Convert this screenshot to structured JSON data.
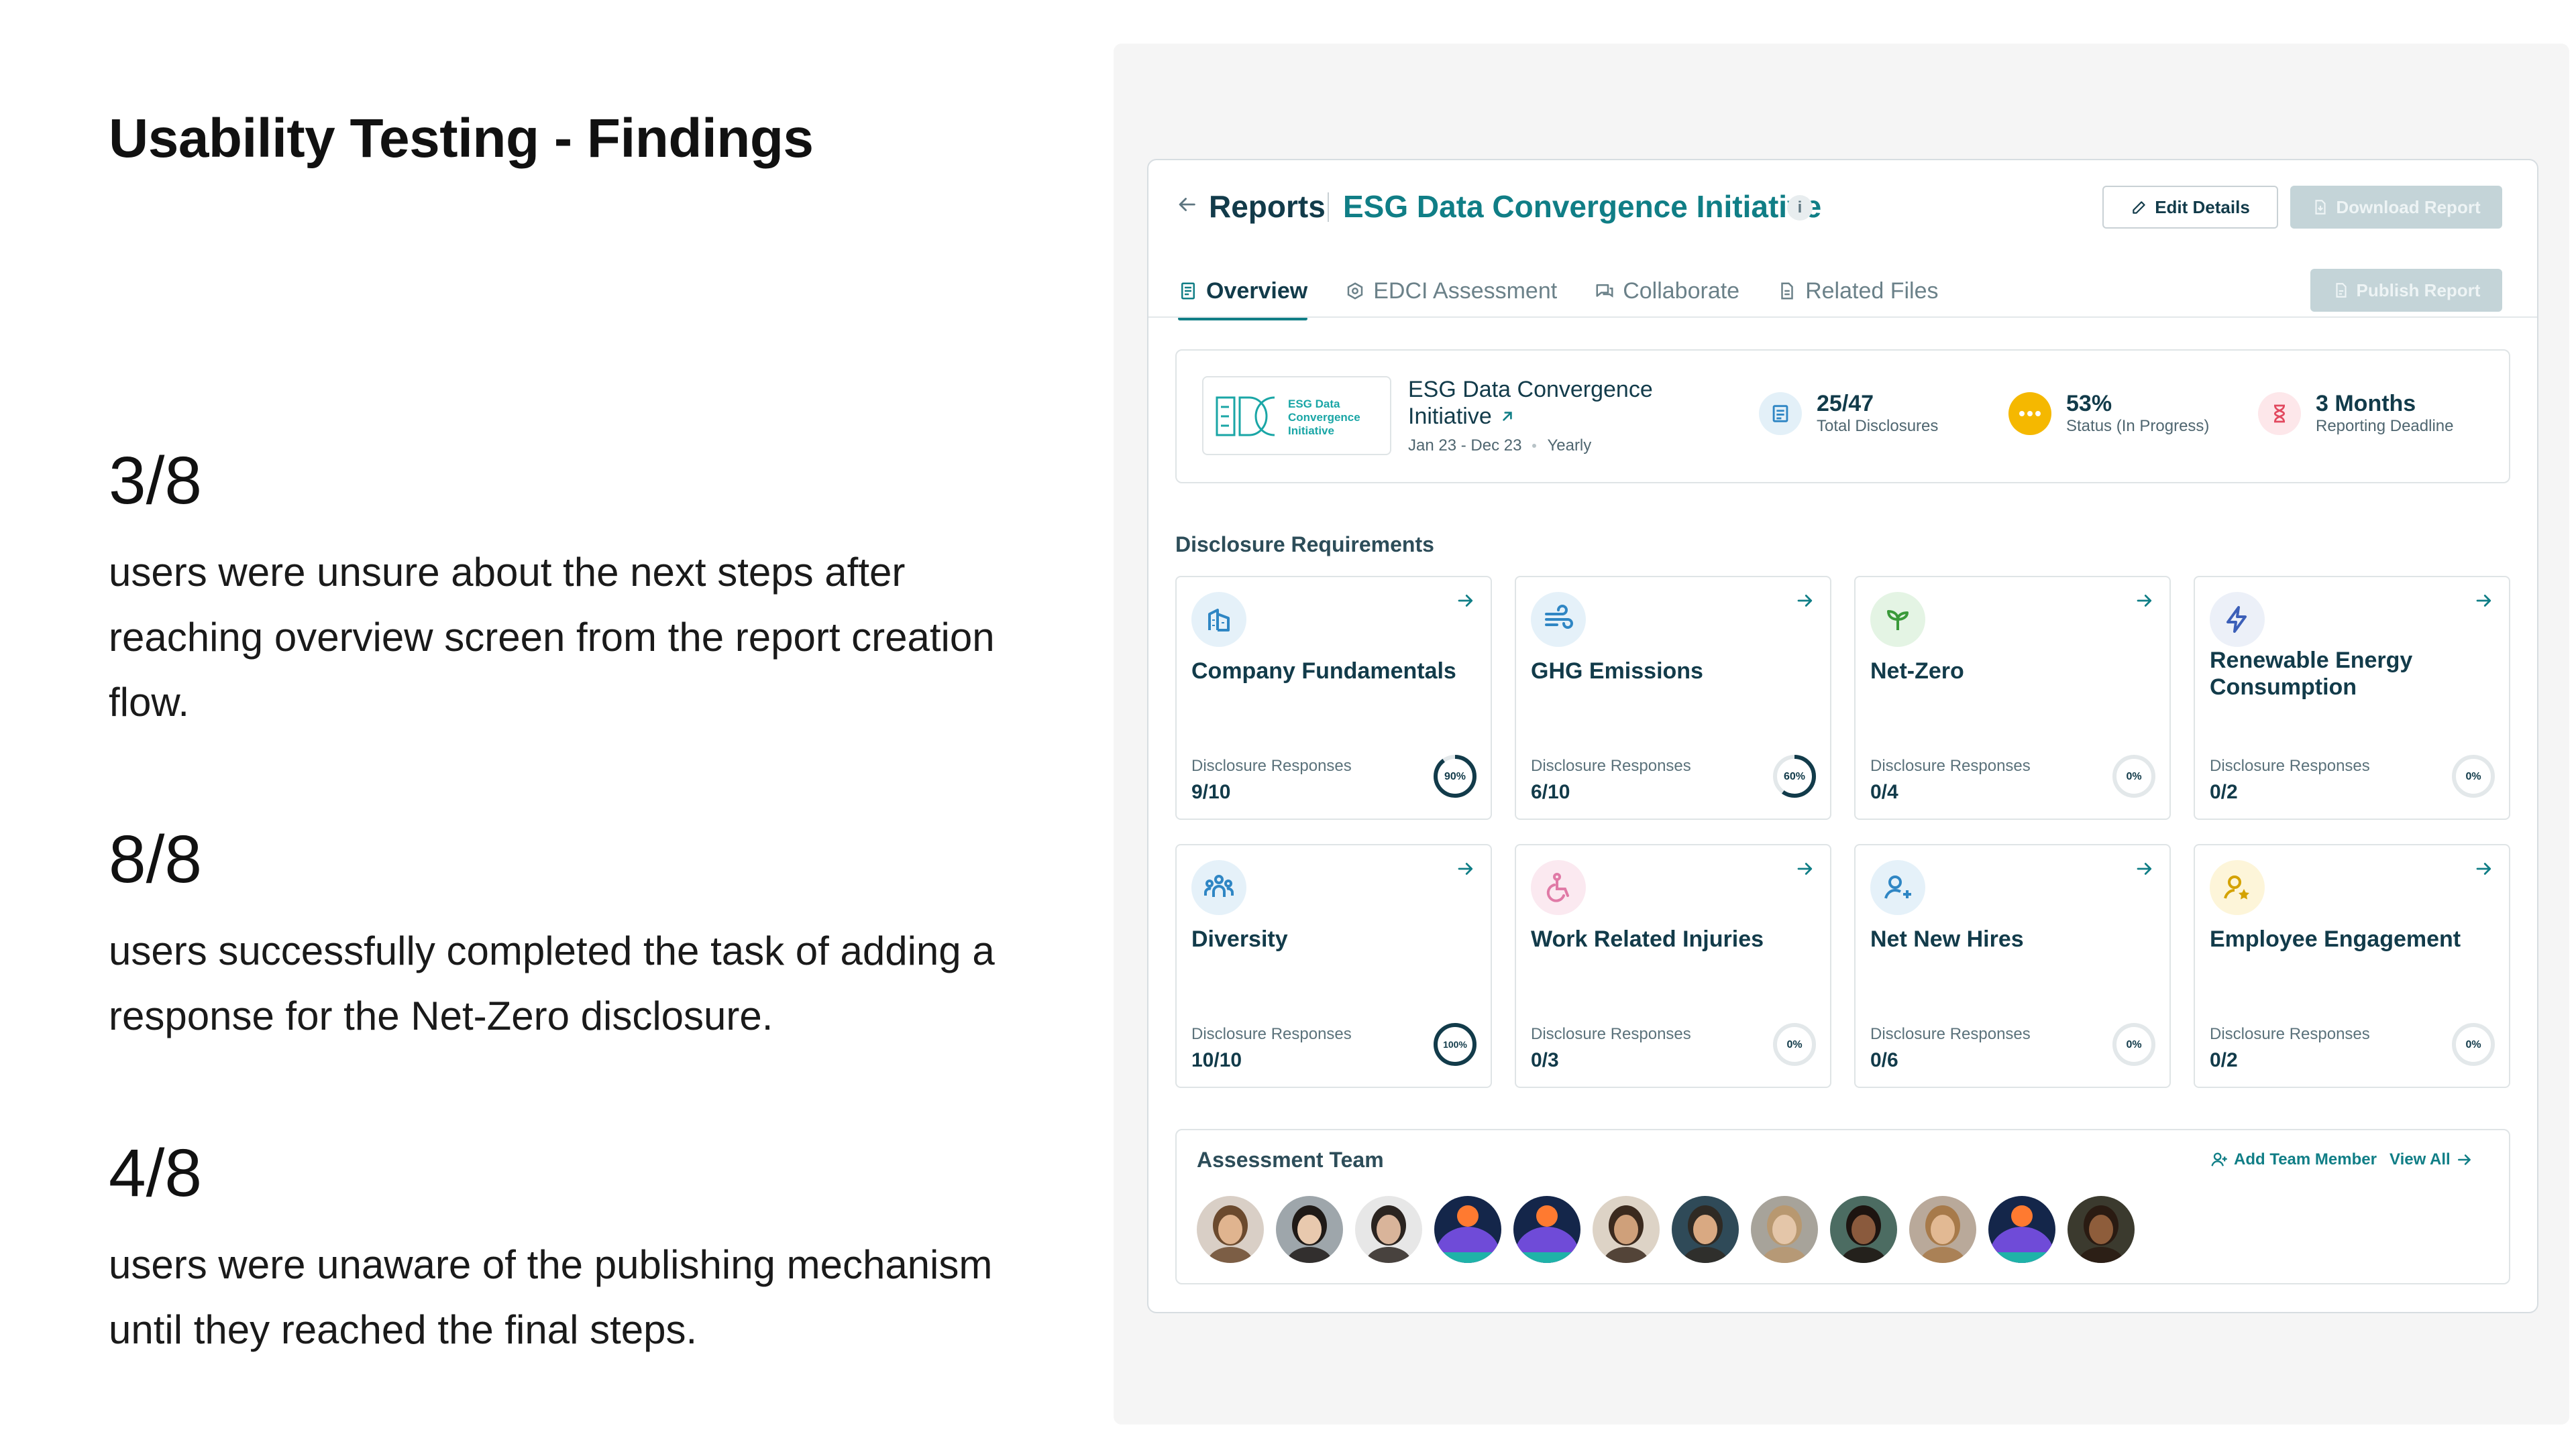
{
  "slide": {
    "title": "Usability Testing - Findings",
    "findings": [
      {
        "stat": "3/8",
        "text": "users were unsure about the next steps after reaching overview screen from the report creation flow."
      },
      {
        "stat": "8/8",
        "text": "users successfully completed the task of adding a response for the Net-Zero disclosure."
      },
      {
        "stat": "4/8",
        "text": "users were unaware of the publishing mechanism until they reached the final steps."
      }
    ]
  },
  "app": {
    "header": {
      "back_icon": "arrow-left-icon",
      "breadcrumb_root": "Reports",
      "report_title": "ESG Data Convergence Initiative",
      "info_icon": "i",
      "edit_button": "Edit Details",
      "download_button": "Download Report",
      "publish_button": "Publish Report"
    },
    "tabs": [
      {
        "label": "Overview",
        "icon": "document-icon",
        "active": true
      },
      {
        "label": "EDCI Assessment",
        "icon": "hexagon-icon",
        "active": false
      },
      {
        "label": "Collaborate",
        "icon": "chat-icon",
        "active": false
      },
      {
        "label": "Related Files",
        "icon": "file-icon",
        "active": false
      }
    ],
    "summary": {
      "logo_text": [
        "ESG Data",
        "Convergence",
        "Initiative"
      ],
      "initiative_name_line1": "ESG Data Convergence",
      "initiative_name_line2": "Initiative",
      "period": "Jan 23 - Dec 23",
      "frequency": "Yearly",
      "metrics": [
        {
          "value": "25/47",
          "label": "Total Disclosures",
          "color": "#e3f0f8",
          "icon": "list-icon"
        },
        {
          "value": "53%",
          "label": "Status (In Progress)",
          "color": "#f5b800",
          "icon": "dots-icon"
        },
        {
          "value": "3 Months",
          "label": "Reporting Deadline",
          "color": "#fde7ea",
          "icon": "hourglass-icon"
        }
      ]
    },
    "disclosure_section_title": "Disclosure Requirements",
    "disclosures": [
      {
        "name": "Company Fundamentals",
        "responses_label": "Disclosure Responses",
        "responses": "9/10",
        "percent_label": "90%",
        "percent": 0.9,
        "icon": "building-icon",
        "icon_bg": "#e5f1f9",
        "icon_color": "#2f86c4"
      },
      {
        "name": "GHG Emissions",
        "responses_label": "Disclosure Responses",
        "responses": "6/10",
        "percent_label": "60%",
        "percent": 0.6,
        "icon": "wind-icon",
        "icon_bg": "#e5f1f9",
        "icon_color": "#2f86c4"
      },
      {
        "name": "Net-Zero",
        "responses_label": "Disclosure Responses",
        "responses": "0/4",
        "percent_label": "0%",
        "percent": 0,
        "icon": "sprout-icon",
        "icon_bg": "#e4f4e4",
        "icon_color": "#3a9a3a"
      },
      {
        "name": "Renewable Energy Consumption",
        "responses_label": "Disclosure Responses",
        "responses": "0/2",
        "percent_label": "0%",
        "percent": 0,
        "icon": "lightning-icon",
        "icon_bg": "#ecf0f8",
        "icon_color": "#3c5fb8"
      },
      {
        "name": "Diversity",
        "responses_label": "Disclosure Responses",
        "responses": "10/10",
        "percent_label": "100%",
        "percent": 1,
        "icon": "people-icon",
        "icon_bg": "#e5f1f9",
        "icon_color": "#2f86c4"
      },
      {
        "name": "Work Related Injuries",
        "responses_label": "Disclosure Responses",
        "responses": "0/3",
        "percent_label": "0%",
        "percent": 0,
        "icon": "wheelchair-icon",
        "icon_bg": "#fbe9f0",
        "icon_color": "#e07aa6"
      },
      {
        "name": "Net New Hires",
        "responses_label": "Disclosure Responses",
        "responses": "0/6",
        "percent_label": "0%",
        "percent": 0,
        "icon": "add-user-icon",
        "icon_bg": "#e5f1f9",
        "icon_color": "#2f86c4"
      },
      {
        "name": "Employee Engagement",
        "responses_label": "Disclosure Responses",
        "responses": "0/2",
        "percent_label": "0%",
        "percent": 0,
        "icon": "user-star-icon",
        "icon_bg": "#fdf5d9",
        "icon_color": "#d4a200"
      }
    ],
    "team": {
      "title": "Assessment Team",
      "add_member": "Add Team Member",
      "view_all": "View All",
      "avatars": [
        {
          "kind": "photo",
          "skin": "#e0b48f",
          "hair": "#6b4a2e",
          "bg": "#d9cfc6"
        },
        {
          "kind": "photo",
          "skin": "#e8c9ae",
          "hair": "#1f1a17",
          "bg": "#9ea6ab"
        },
        {
          "kind": "photo",
          "skin": "#d9b49a",
          "hair": "#2b2420",
          "bg": "#e7e7e7"
        },
        {
          "kind": "placeholder"
        },
        {
          "kind": "placeholder"
        },
        {
          "kind": "photo",
          "skin": "#cfa07a",
          "hair": "#3b2a1e",
          "bg": "#ddd3c6"
        },
        {
          "kind": "photo",
          "skin": "#d9a982",
          "hair": "#2f2a24",
          "bg": "#2f4a58"
        },
        {
          "kind": "photo",
          "skin": "#e4c6a9",
          "hair": "#b89870",
          "bg": "#a7a39a"
        },
        {
          "kind": "photo",
          "skin": "#8a5a3d",
          "hair": "#1d1410",
          "bg": "#4c6c62"
        },
        {
          "kind": "photo",
          "skin": "#e2b993",
          "hair": "#a77a4a",
          "bg": "#b9a99a"
        },
        {
          "kind": "placeholder"
        },
        {
          "kind": "photo",
          "skin": "#8e5d3b",
          "hair": "#2a1b12",
          "bg": "#3b3a2e"
        }
      ]
    },
    "colors": {
      "teal": "#107e86",
      "navy": "#123b4a",
      "placeholder_top": "#ff7a30",
      "placeholder_mid": "#6f4bd8",
      "placeholder_bottom": "#1fb3a8"
    }
  }
}
